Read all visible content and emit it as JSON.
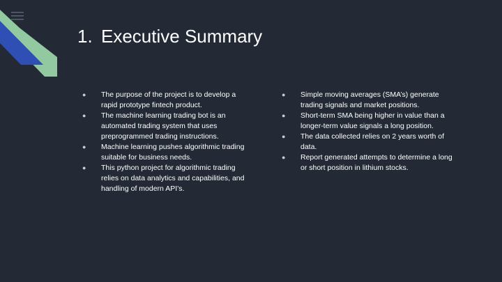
{
  "slide": {
    "title_number": "1.",
    "title_text": "Executive Summary",
    "left_bullets": [
      "The purpose of the project is to develop a rapid prototype fintech product.",
      "The machine learning trading bot is an automated trading system that uses preprogrammed trading instructions.",
      "Machine learning pushes algorithmic trading suitable for business needs.",
      "This python project for algorithmic trading relies on data analytics and capabilities, and handling of modern API’s."
    ],
    "right_bullets": [
      "Simple moving averages (SMA’s) generate trading signals and market positions.",
      "Short-term SMA being higher in value than a longer-term value signals a long position.",
      "The data collected relies on 2 years worth of data.",
      "Report generated attempts to determine a long or short position  in lithium stocks."
    ],
    "bullet_glyph": "●"
  },
  "colors": {
    "background": "#232a35",
    "accent_blue": "#2f4fb5",
    "accent_green": "#93c9a0",
    "text": "#ffffff"
  },
  "icons": {
    "menu": "hamburger-menu-icon"
  }
}
